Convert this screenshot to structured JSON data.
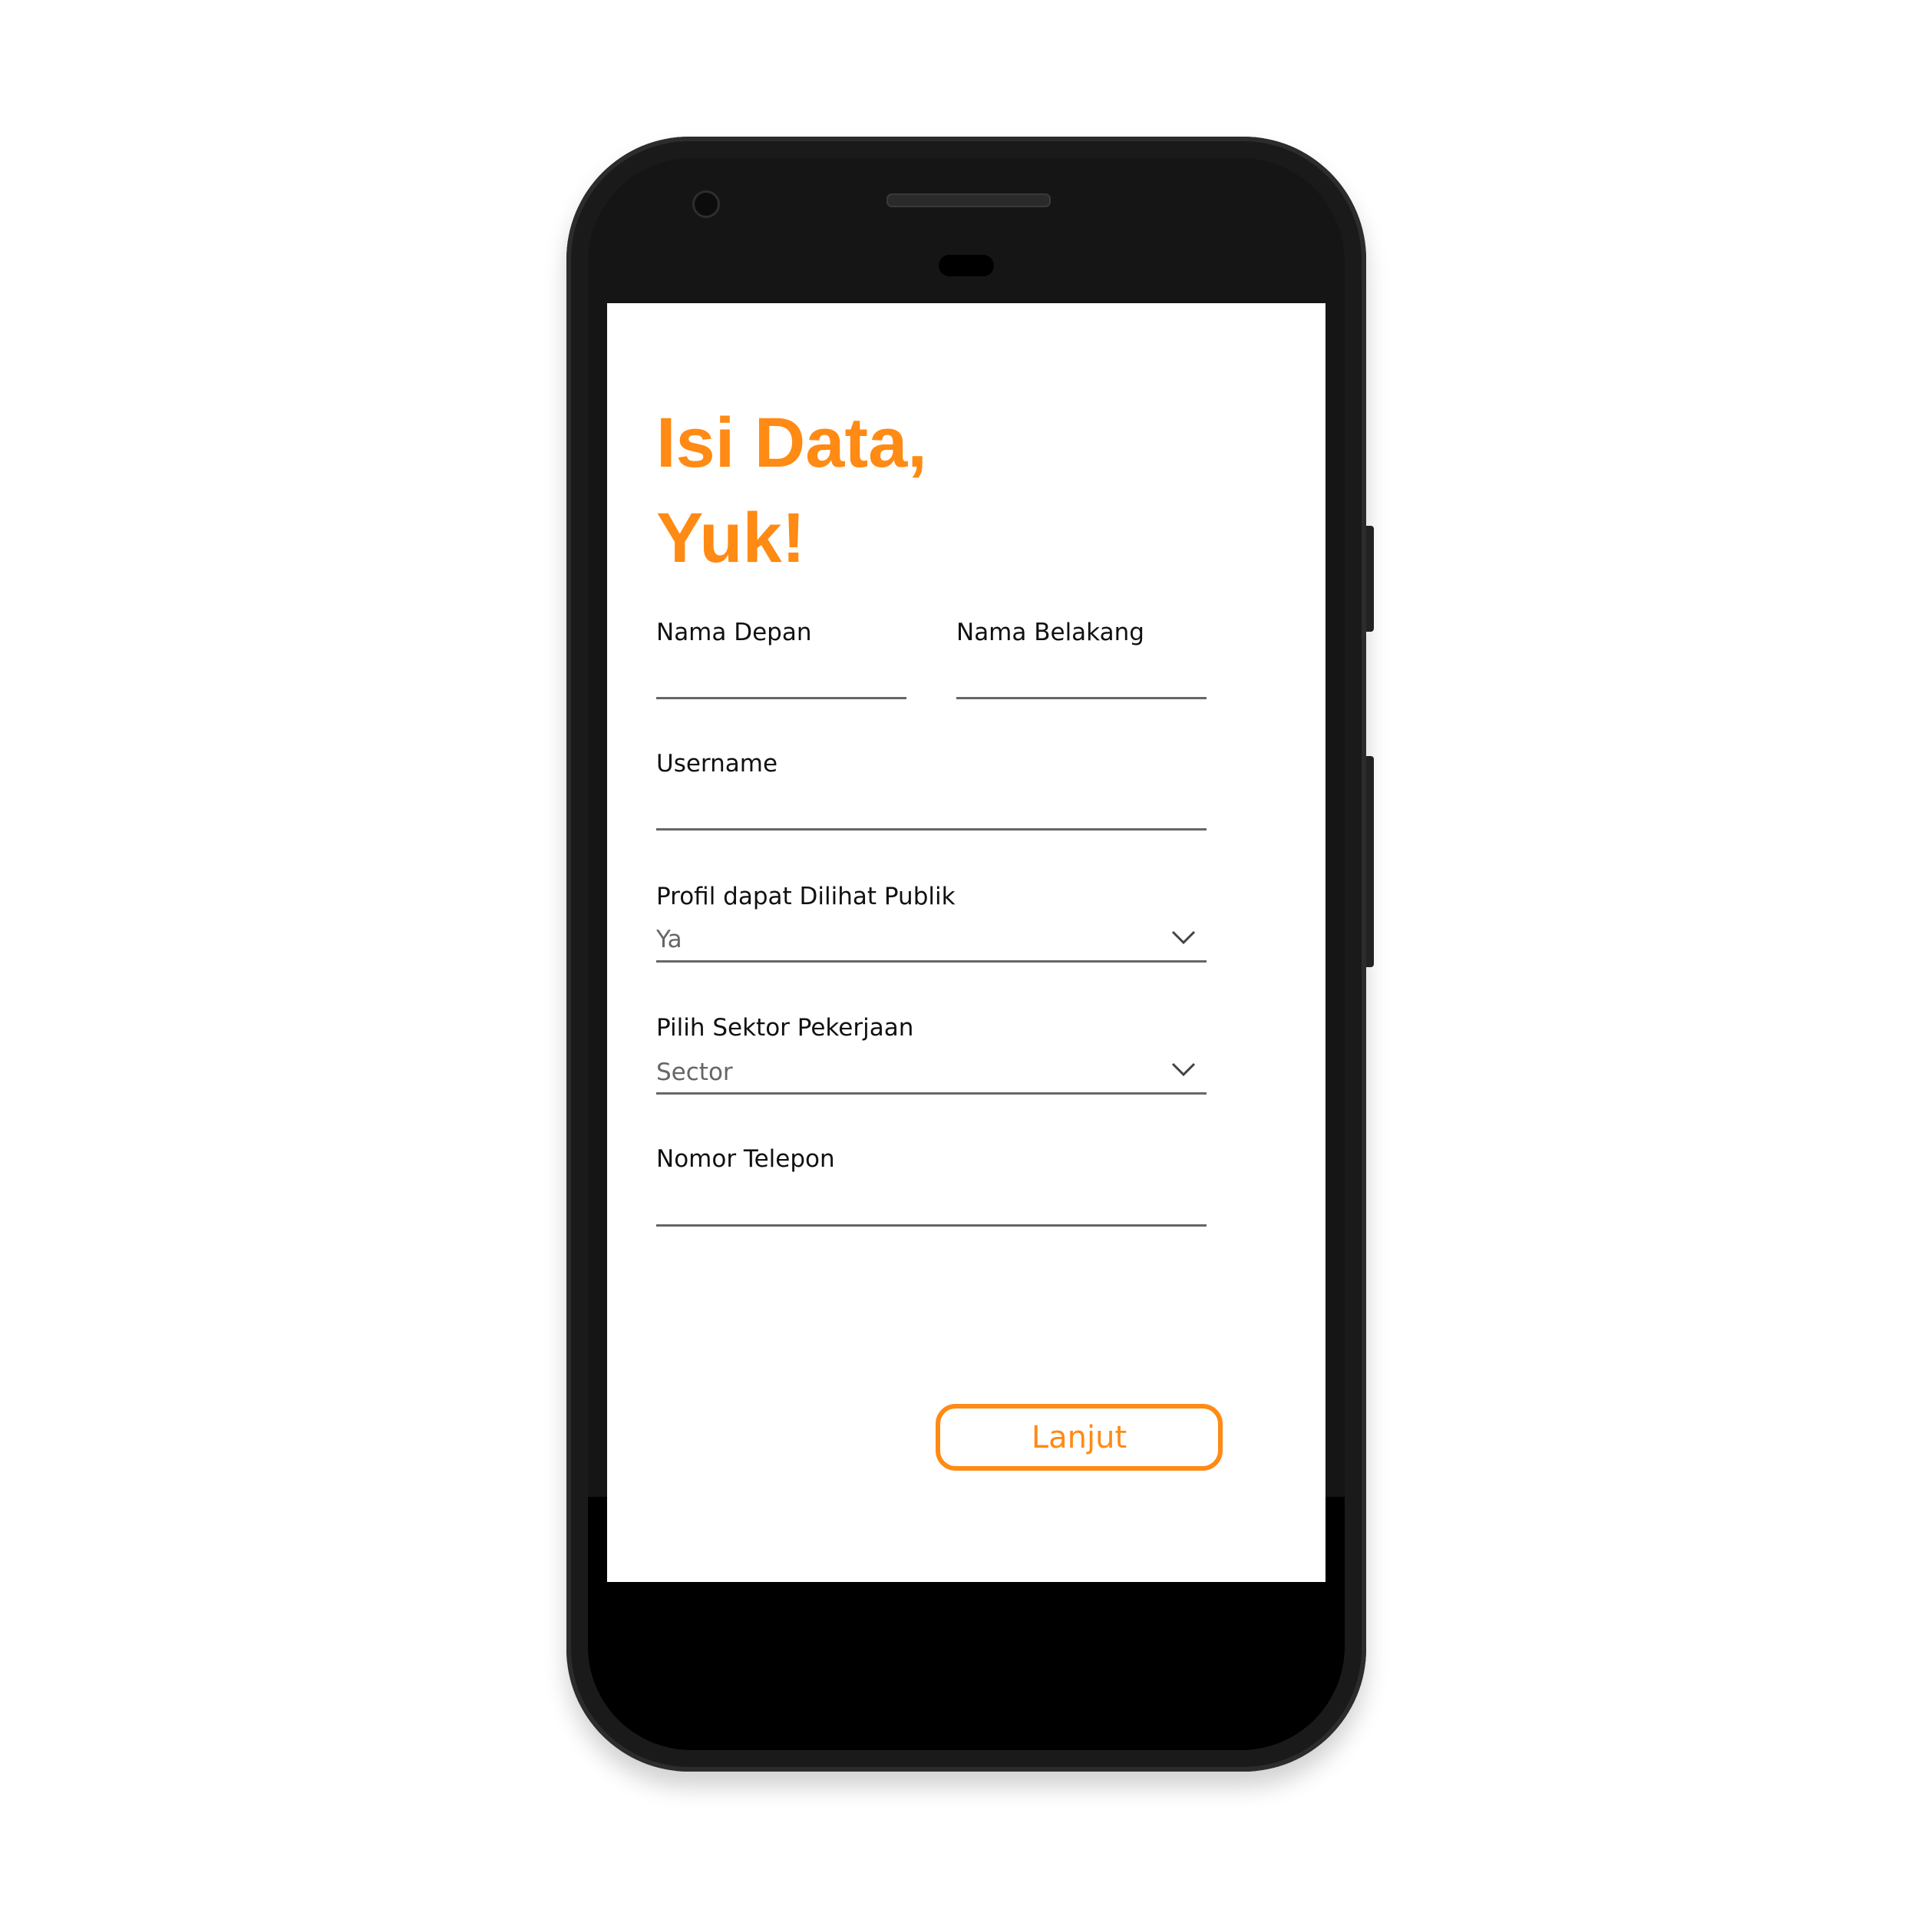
{
  "header": {
    "line1": "Isi Data,",
    "line2": "Yuk!"
  },
  "form": {
    "first_name_label": "Nama Depan",
    "last_name_label": "Nama Belakang",
    "username_label": "Username",
    "public_profile_label": "Profil dapat Dilihat Publik",
    "public_profile_value": "Ya",
    "sector_label": "Pilih Sektor Pekerjaan",
    "sector_placeholder": "Sector",
    "phone_label": "Nomor Telepon"
  },
  "actions": {
    "next_label": "Lanjut"
  },
  "colors": {
    "accent": "#ff8a14"
  }
}
